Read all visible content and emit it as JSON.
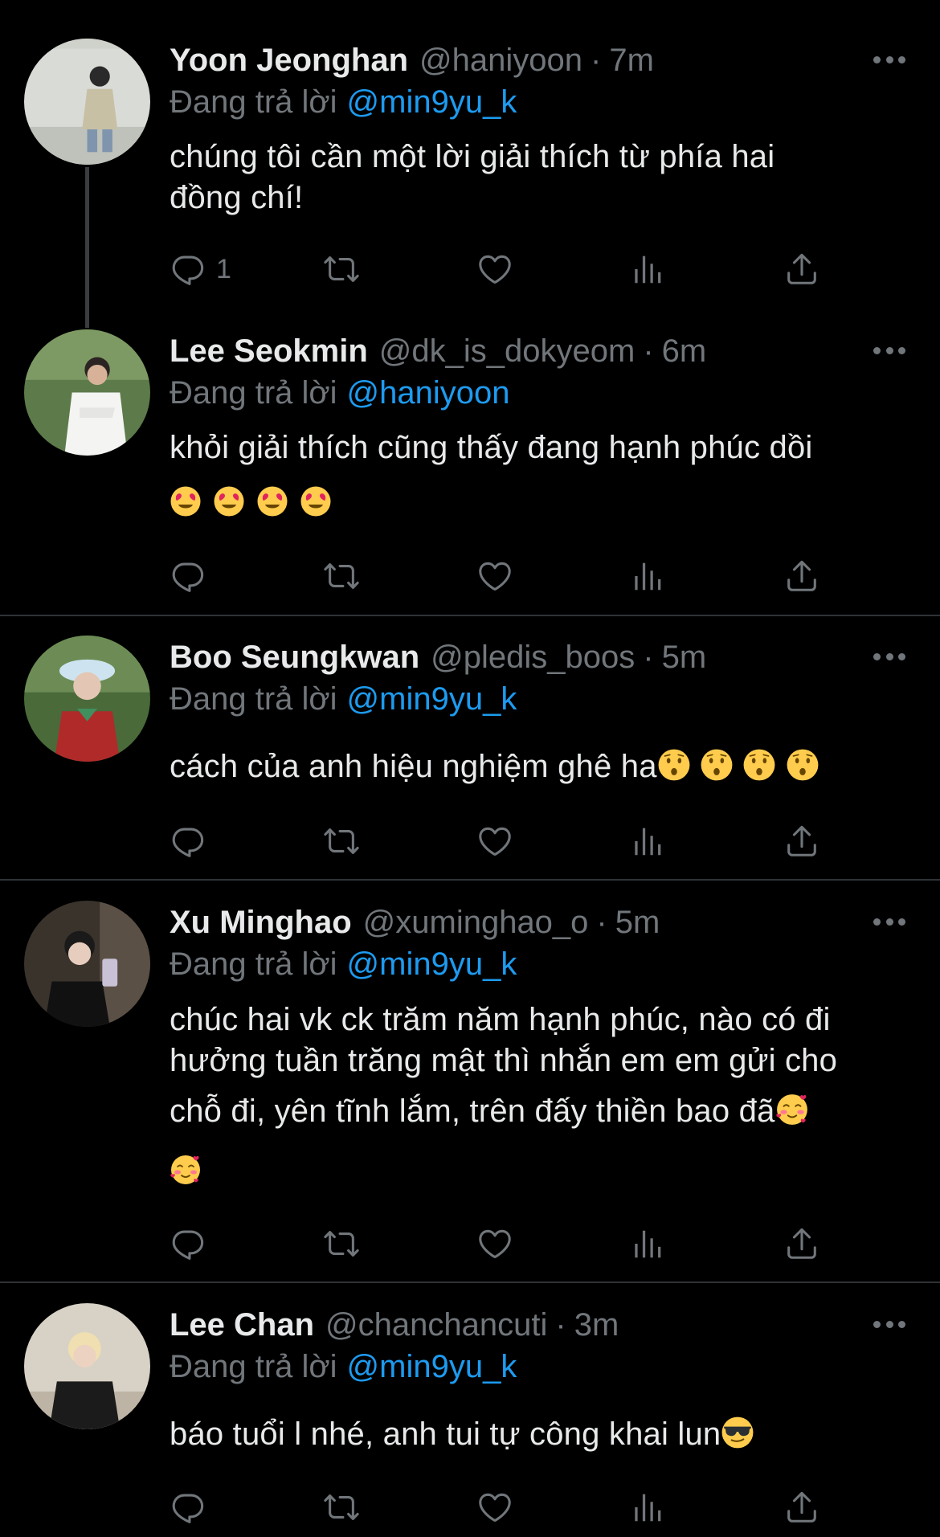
{
  "reply_prefix": "Đang trả lời",
  "tweets": [
    {
      "name": "Yoon Jeonghan",
      "handle": "@haniyoon",
      "time": "7m",
      "replying_to": "@min9yu_k",
      "lines": [
        "chúng tôi cần một lời giải thích từ phía hai",
        "đồng chí!"
      ],
      "reply_count": "1"
    },
    {
      "name": "Lee Seokmin",
      "handle": "@dk_is_dokyeom",
      "time": "6m",
      "replying_to": "@haniyoon",
      "lines": [
        "khỏi giải thích cũng thấy đang hạnh phúc dồi"
      ],
      "emoji": "😍😍😍😍"
    },
    {
      "name": "Boo Seungkwan",
      "handle": "@pledis_boos",
      "time": "5m",
      "replying_to": "@min9yu_k",
      "lines": [
        "cách của anh hiệu nghiệm ghê ha"
      ],
      "emoji": "😲😲😲😲"
    },
    {
      "name": "Xu Minghao",
      "handle": "@xuminghao_o",
      "time": "5m",
      "replying_to": "@min9yu_k",
      "lines": [
        "chúc hai vk ck trăm năm hạnh phúc, nào có đi",
        "hưởng tuần trăng mật thì nhắn em em gửi cho",
        "chỗ đi, yên tĩnh lắm, trên đấy thiền bao đã"
      ],
      "emoji": "🥰🥰"
    },
    {
      "name": "Lee Chan",
      "handle": "@chanchancuti",
      "time": "3m",
      "replying_to": "@min9yu_k",
      "lines": [
        "báo tuổi l nhé, anh tui tự công khai lun"
      ],
      "emoji": "😎"
    }
  ],
  "icons": {
    "reply": "reply-icon",
    "retweet": "retweet-icon",
    "like": "heart-icon",
    "views": "views-icon",
    "share": "share-icon",
    "more": "more-icon"
  },
  "colors": {
    "background": "#000000",
    "text": "#e7e9ea",
    "muted": "#71767b",
    "link": "#1d9bf0",
    "divider": "#2f3336"
  }
}
